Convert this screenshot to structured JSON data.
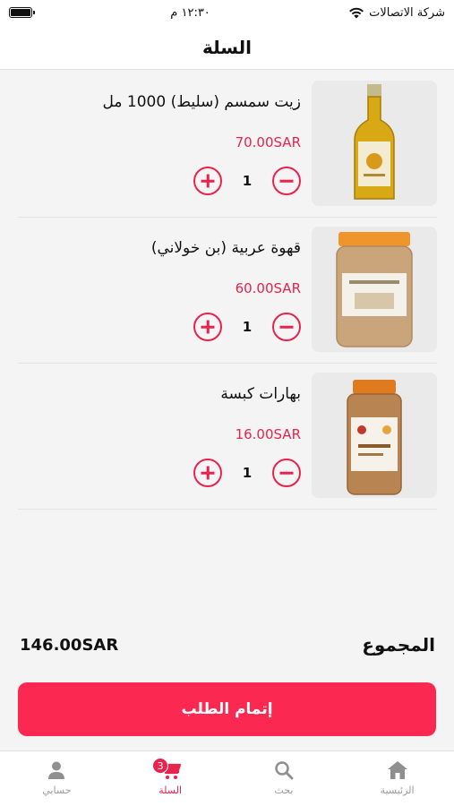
{
  "status": {
    "carrier": "شركة الاتصالات",
    "time": "١٢:٣٠ م"
  },
  "header": {
    "title": "السلة"
  },
  "cart": {
    "items": [
      {
        "name": "زيت سمسم (سليط) 1000 مل",
        "price": "70.00SAR",
        "qty": "1"
      },
      {
        "name": "قهوة عربية (بن خولاني)",
        "price": "60.00SAR",
        "qty": "1"
      },
      {
        "name": "بهارات كبسة",
        "price": "16.00SAR",
        "qty": "1"
      }
    ]
  },
  "total": {
    "label": "المجموع",
    "value": "146.00SAR"
  },
  "checkout": {
    "label": "إتمام الطلب"
  },
  "tabs": {
    "account": "حسابي",
    "cart": "السلة",
    "cart_badge": "3",
    "search": "بحث",
    "home": "الرئيسية"
  },
  "colors": {
    "accent": "#e8234e",
    "button": "#fb2852",
    "inactive": "#9a9a9a"
  },
  "icons": [
    "wifi-icon",
    "battery-icon",
    "plus-icon",
    "minus-icon",
    "person-icon",
    "cart-icon",
    "search-icon",
    "home-icon"
  ]
}
